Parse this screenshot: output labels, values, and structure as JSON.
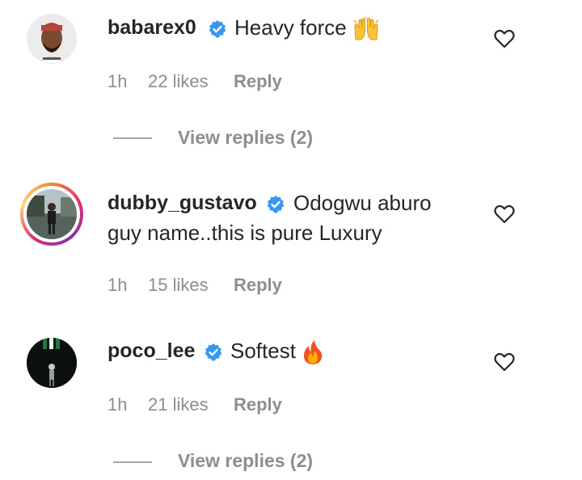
{
  "comments": [
    {
      "username": "babarex0",
      "verified": true,
      "text": "Heavy force",
      "emoji": "raising-hands-icon",
      "time": "1h",
      "likes": "22 likes",
      "reply_label": "Reply",
      "view_replies": "View replies (2)",
      "avatar_ring": false
    },
    {
      "username": "dubby_gustavo",
      "verified": true,
      "text_line1": "Odogwu aburo",
      "text_line2": "guy name..this is pure Luxury",
      "time": "1h",
      "likes": "15 likes",
      "reply_label": "Reply",
      "avatar_ring": true
    },
    {
      "username": "poco_lee",
      "verified": true,
      "text": "Softest",
      "emoji": "fire-icon",
      "time": "1h",
      "likes": "21 likes",
      "reply_label": "Reply",
      "view_replies": "View replies (2)",
      "avatar_ring": false
    }
  ],
  "colors": {
    "text": "#262626",
    "meta": "#8e8e8e",
    "verified_blue": "#3897f0",
    "background": "#ffffff"
  }
}
